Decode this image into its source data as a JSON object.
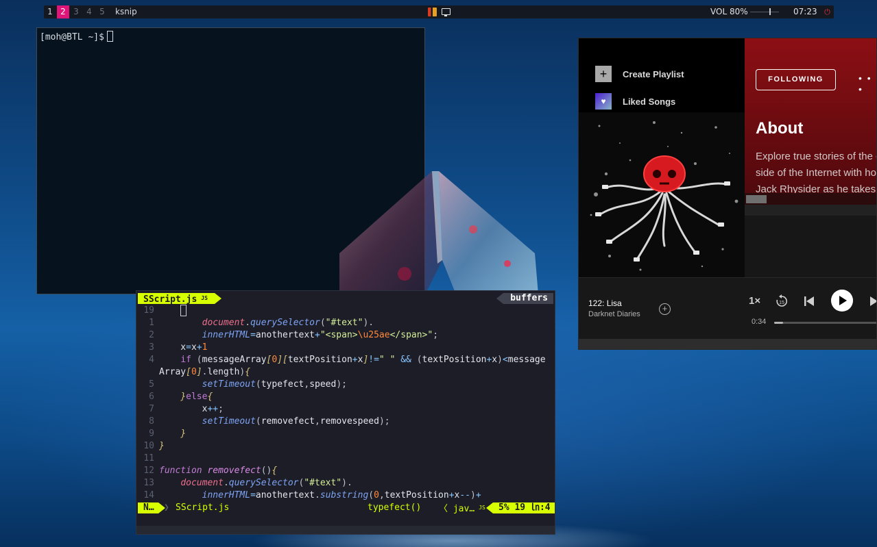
{
  "topbar": {
    "workspaces": [
      "1",
      "2",
      "3",
      "4",
      "5"
    ],
    "active_workspace": "2",
    "app_title": "ksnip",
    "volume": "VOL 80%",
    "volume_level": 0.8,
    "clock": "07:23",
    "icons": [
      "app-tray-icon",
      "display-icon",
      "power-icon"
    ]
  },
  "terminal": {
    "prompt": "[moh@BTL ~]$"
  },
  "spotify": {
    "sidebar": {
      "create_playlist": "Create Playlist",
      "liked_songs": "Liked Songs"
    },
    "main": {
      "follow_button": "FOLLOWING",
      "more": "• • •",
      "about_heading": "About",
      "description_lines": [
        "Explore true stories of the dark",
        "side of the Internet with host",
        "Jack Rhysider as he takes you"
      ]
    },
    "player": {
      "title": "122: Lisa",
      "artist": "Darknet Diaries",
      "speed": "1×",
      "skip_back": "15",
      "elapsed": "0:34",
      "progress": 0.08
    },
    "colors": {
      "header_red": "#8c0f14",
      "background": "#121212"
    }
  },
  "vim": {
    "tab_file": "SScript.js",
    "tab_file_badge": "JS",
    "buffers_label": "buffers",
    "status": {
      "mode": "N…",
      "file": "SScript.js",
      "function": "typefect()",
      "separator": "〈",
      "lang": "jav…",
      "lang_badge": "JS",
      "position": "5%",
      "line_col": "19 ㏑:4"
    },
    "accent": "#d7ff00"
  }
}
